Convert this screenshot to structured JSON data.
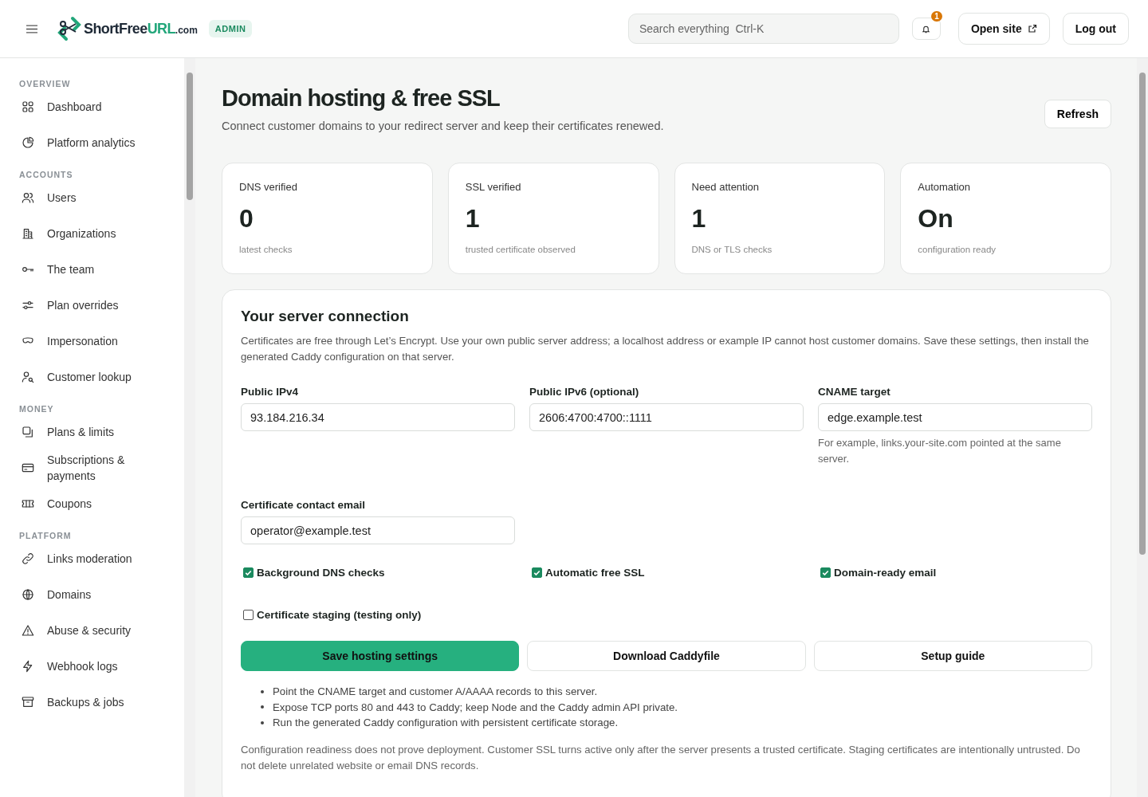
{
  "header": {
    "logo": {
      "name": "ShortFree",
      "highlight": "URL",
      "suffix": ".com"
    },
    "badge": "ADMIN",
    "search": {
      "placeholder": "Search everything  Ctrl-K"
    },
    "notifications": {
      "count": "1"
    },
    "buttons": [
      {
        "label": "Open site",
        "kind": "external"
      },
      {
        "label": "Log out",
        "kind": "plain"
      }
    ]
  },
  "sidebar": {
    "sections": [
      {
        "title": "OVERVIEW",
        "items": [
          {
            "label": "Dashboard",
            "kind": "grid",
            "selected": false
          },
          {
            "label": "Platform analytics",
            "kind": "pie",
            "selected": false
          }
        ]
      },
      {
        "title": "ACCOUNTS",
        "items": [
          {
            "label": "Users",
            "kind": "users",
            "selected": false
          },
          {
            "label": "Organizations",
            "kind": "building",
            "selected": false
          },
          {
            "label": "The team",
            "kind": "key",
            "selected": false
          },
          {
            "label": "Plan overrides",
            "kind": "sliders",
            "selected": false
          },
          {
            "label": "Impersonation",
            "kind": "mask",
            "selected": false
          },
          {
            "label": "Customer lookup",
            "kind": "usersearch",
            "selected": false
          }
        ]
      },
      {
        "title": "MONEY",
        "items": [
          {
            "label": "Plans & limits",
            "kind": "layers",
            "selected": false
          },
          {
            "label": "Subscriptions & payments",
            "kind": "card",
            "selected": false
          },
          {
            "label": "Coupons",
            "kind": "ticket",
            "selected": false
          }
        ]
      },
      {
        "title": "PLATFORM",
        "items": [
          {
            "label": "Links moderation",
            "kind": "link",
            "selected": false
          },
          {
            "label": "Domains",
            "kind": "globe",
            "selected": false
          },
          {
            "label": "Abuse & security",
            "kind": "warning",
            "selected": false
          },
          {
            "label": "Webhook logs",
            "kind": "bolt",
            "selected": false
          },
          {
            "label": "Backups & jobs",
            "kind": "archive",
            "selected": false
          }
        ]
      }
    ]
  },
  "page": {
    "title": "Domain hosting & free SSL",
    "subtitle": "Connect customer domains to your redirect server and keep their certificates renewed.",
    "refresh": "Refresh"
  },
  "stats": [
    {
      "label": "DNS verified",
      "value": "0",
      "note": "latest checks"
    },
    {
      "label": "SSL verified",
      "value": "1",
      "note": "trusted certificate observed"
    },
    {
      "label": "Need attention",
      "value": "1",
      "note": "DNS or TLS checks"
    },
    {
      "label": "Automation",
      "value": "On",
      "note": "configuration ready"
    }
  ],
  "server": {
    "title": "Your server connection",
    "description": "Certificates are free through Let’s Encrypt. Use your own public server address; a localhost address or example IP cannot host customer domains. Save these settings, then install the generated Caddy configuration on that server.",
    "fields": [
      {
        "label": "Public IPv4",
        "value": "93.184.216.34"
      },
      {
        "label": "Public IPv6 (optional)",
        "value": "2606:4700:4700::1111"
      },
      {
        "label": "CNAME target",
        "value": "edge.example.test",
        "hint": "For example, links.your-site.com pointed at the same server."
      },
      {
        "label": "Certificate contact email",
        "value": "operator@example.test"
      }
    ],
    "options": [
      {
        "label": "Background DNS checks",
        "checked": true
      },
      {
        "label": "Automatic free SSL",
        "checked": true
      },
      {
        "label": "Domain-ready email",
        "checked": true
      },
      {
        "label": "Certificate staging (testing only)",
        "checked": false
      }
    ],
    "actions": [
      {
        "label": "Save hosting settings",
        "kind": "primary"
      },
      {
        "label": "Download Caddyfile",
        "kind": "secondary"
      },
      {
        "label": "Setup guide",
        "kind": "secondary"
      }
    ],
    "steps": [
      "Point the CNAME target and customer A/AAAA records to this server.",
      "Expose TCP ports 80 and 443 to Caddy; keep Node and the Caddy admin API private.",
      "Run the generated Caddy configuration with persistent certificate storage."
    ],
    "footnote": "Configuration readiness does not prove deployment. Customer SSL turns active only after the server presents a trusted certificate. Staging certificates are intentionally untrusted. Do not delete unrelated website or email DNS records."
  }
}
